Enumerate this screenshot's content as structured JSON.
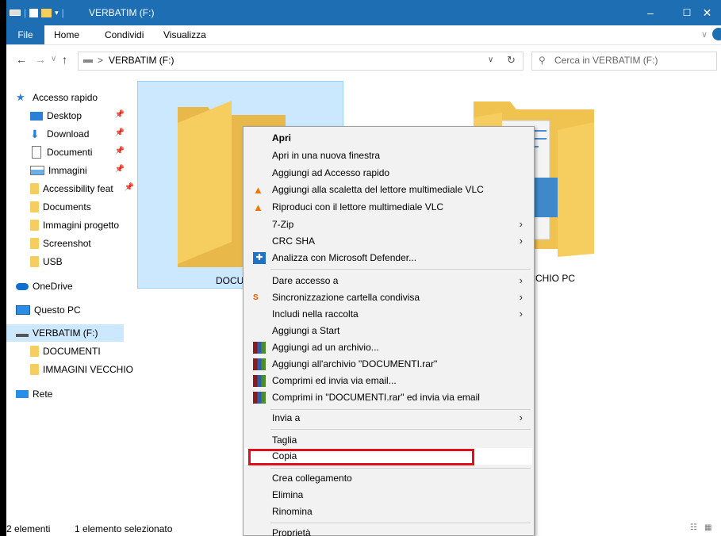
{
  "window": {
    "title": "VERBATIM (F:)",
    "controls": {
      "minimize": "–",
      "maximize": "☐",
      "close": "✕"
    }
  },
  "ribbon": {
    "file_tab": "File",
    "tabs": [
      "Home",
      "Condividi",
      "Visualizza"
    ]
  },
  "address_bar": {
    "path_separator": ">",
    "path": "VERBATIM (F:)",
    "search_placeholder": "Cerca in VERBATIM (F:)"
  },
  "navigation": {
    "quick_access": "Accesso rapido",
    "quick_items": [
      {
        "label": "Desktop",
        "icon": "desktop-icon",
        "pinned": true
      },
      {
        "label": "Download",
        "icon": "download-icon",
        "pinned": true
      },
      {
        "label": "Documenti",
        "icon": "documents-icon",
        "pinned": true
      },
      {
        "label": "Immagini",
        "icon": "pictures-icon",
        "pinned": true
      },
      {
        "label": "Accessibility feat",
        "icon": "folder-icon",
        "pinned": true
      },
      {
        "label": "Documents",
        "icon": "folder-icon",
        "pinned": false
      },
      {
        "label": "Immagini progetto",
        "icon": "folder-icon",
        "pinned": false
      },
      {
        "label": "Screenshot",
        "icon": "folder-icon",
        "pinned": false
      },
      {
        "label": "USB",
        "icon": "folder-icon",
        "pinned": false
      }
    ],
    "onedrive": "OneDrive",
    "this_pc": "Questo PC",
    "drive": "VERBATIM (F:)",
    "drive_folders": [
      "DOCUMENTI",
      "IMMAGINI VECCHIO"
    ],
    "network": "Rete"
  },
  "content": {
    "items": [
      {
        "label": "DOCUMENTI",
        "selected": true
      },
      {
        "label": "IMMAGINI VECCHIO PC",
        "selected": false
      }
    ]
  },
  "context_menu": {
    "items": [
      {
        "label": "Apri",
        "bold": true
      },
      {
        "label": "Apri in una nuova finestra"
      },
      {
        "label": "Aggiungi ad Accesso rapido"
      },
      {
        "label": "Aggiungi alla scaletta del lettore multimediale VLC",
        "icon": "vlc-icon"
      },
      {
        "label": "Riproduci con il lettore multimediale VLC",
        "icon": "vlc-icon"
      },
      {
        "label": "7-Zip",
        "submenu": true
      },
      {
        "label": "CRC SHA",
        "submenu": true
      },
      {
        "label": "Analizza con Microsoft Defender...",
        "icon": "defender-icon"
      },
      {
        "label": "Dare accesso a",
        "submenu": true
      },
      {
        "label": "Sincronizzazione cartella condivisa",
        "icon": "sync-icon",
        "submenu": true
      },
      {
        "label": "Includi nella raccolta",
        "submenu": true
      },
      {
        "label": "Aggiungi a Start"
      },
      {
        "label": "Aggiungi ad un archivio...",
        "icon": "winrar-icon"
      },
      {
        "label": "Aggiungi all'archivio \"DOCUMENTI.rar\"",
        "icon": "winrar-icon"
      },
      {
        "label": "Comprimi ed invia via email...",
        "icon": "winrar-icon"
      },
      {
        "label": "Comprimi in \"DOCUMENTI.rar\" ed invia via email",
        "icon": "winrar-icon"
      },
      {
        "label": "Invia a",
        "submenu": true
      },
      {
        "label": "Taglia"
      },
      {
        "label": "Copia",
        "highlighted": true
      },
      {
        "label": "Crea collegamento"
      },
      {
        "label": "Elimina"
      },
      {
        "label": "Rinomina"
      },
      {
        "label": "Proprietà"
      }
    ],
    "submenu_arrow": "›"
  },
  "status_bar": {
    "count": "2 elementi",
    "selection": "1 elemento selezionato"
  },
  "colors": {
    "accent": "#1e6eb4",
    "selection": "#cce8ff",
    "folder": "#f6cd5f",
    "highlight_border": "#e0101a"
  }
}
